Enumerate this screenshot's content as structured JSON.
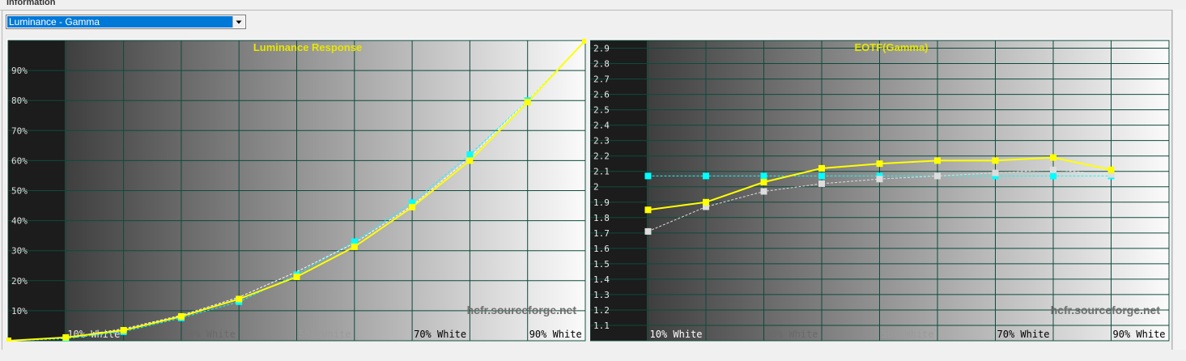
{
  "panel": {
    "title": "Information",
    "selector_value": "Luminance - Gamma"
  },
  "watermark": "hcfr.sourceforge.net",
  "chart_data": [
    {
      "type": "line",
      "title": "Luminance Response",
      "x_tick_labels": [
        "10% White",
        "30% White",
        "50% White",
        "70% White",
        "90% White"
      ],
      "y_tick_labels": [
        "10%",
        "20%",
        "30%",
        "40%",
        "50%",
        "60%",
        "70%",
        "80%",
        "90%"
      ],
      "x": [
        0,
        10,
        20,
        30,
        40,
        50,
        60,
        70,
        80,
        90,
        100
      ],
      "xlim": [
        0,
        100
      ],
      "ylim": [
        0,
        100
      ],
      "grid": true,
      "series": [
        {
          "color": "#ffff00",
          "style": "solid",
          "marker": "square",
          "values": [
            0,
            1.1,
            3.5,
            8.1,
            13.9,
            21.3,
            31.3,
            44.5,
            60.0,
            79.5,
            100
          ]
        },
        {
          "color": "#00ffff",
          "style": "dashed",
          "marker": "square",
          "values": [
            0,
            0.7,
            3.0,
            7.6,
            13.0,
            22.0,
            33.0,
            46.0,
            62.0,
            80.0,
            100
          ]
        },
        {
          "color": "#ffffff",
          "style": "dashed",
          "marker": "none",
          "values": [
            0,
            1.0,
            4.0,
            8.5,
            14.5,
            23.0,
            32.5,
            45.0,
            61.0,
            80.0,
            100
          ]
        }
      ]
    },
    {
      "type": "line",
      "title": "EOTF(Gamma)",
      "x_tick_labels": [
        "10% White",
        "30% White",
        "50% White",
        "70% White",
        "90% White"
      ],
      "y_tick_labels": [
        "1.1",
        "1.2",
        "1.3",
        "1.4",
        "1.5",
        "1.6",
        "1.7",
        "1.8",
        "1.9",
        "2",
        "2.1",
        "2.2",
        "2.3",
        "2.4",
        "2.5",
        "2.6",
        "2.7",
        "2.8",
        "2.9"
      ],
      "x": [
        10,
        20,
        30,
        40,
        50,
        60,
        70,
        80,
        90
      ],
      "xlim": [
        0,
        100
      ],
      "ylim": [
        1.0,
        2.95
      ],
      "grid": true,
      "series": [
        {
          "color": "#ffff00",
          "style": "solid",
          "marker": "square",
          "values": [
            1.85,
            1.9,
            2.03,
            2.12,
            2.15,
            2.17,
            2.17,
            2.19,
            2.11
          ]
        },
        {
          "color": "#00ffff",
          "style": "dashed",
          "marker": "square",
          "values": [
            2.07,
            2.07,
            2.07,
            2.07,
            2.07,
            2.07,
            2.07,
            2.07,
            2.07
          ]
        },
        {
          "color": "#dddddd",
          "style": "dashed",
          "marker": "square",
          "values": [
            1.71,
            1.87,
            1.97,
            2.02,
            2.05,
            2.07,
            2.09,
            2.11,
            2.08
          ]
        }
      ]
    }
  ]
}
